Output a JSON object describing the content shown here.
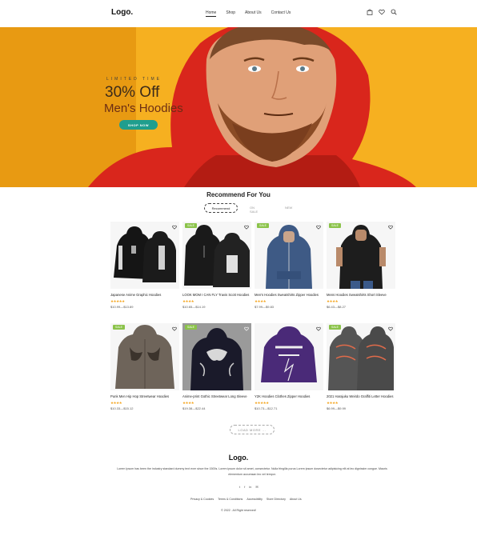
{
  "header": {
    "logo": "Logo.",
    "nav": [
      "Home",
      "Shop",
      "About Us",
      "Contact Us"
    ]
  },
  "hero": {
    "kicker": "LIMITED TIME",
    "title_line1": "30% Off",
    "title_line2": "Men's Hoodies",
    "button": "SHOP NOW"
  },
  "section": {
    "title": "Recommend For You",
    "tabs": [
      "Recommend",
      "ON SALE",
      "NEW"
    ]
  },
  "products": [
    {
      "name": "Japanese Anime Graphic Hoodies",
      "stars": "★★★★★",
      "price": "$10.99—$13.89",
      "sale": false,
      "sale_label": ""
    },
    {
      "name": "LOOK MOM I CAN FLY Travis Scott Hoodies",
      "stars": "★★★★",
      "price": "$10.65—$14.19",
      "sale": true,
      "sale_label": "SALE"
    },
    {
      "name": "Men's Hoodies Sweatshirts Zipper Hoodies",
      "stars": "★★★★",
      "price": "$7.99—$9.83",
      "sale": true,
      "sale_label": "SALE"
    },
    {
      "name": "Mens Hoodies Sweatshirts Short Sleeve",
      "stars": "★★★★",
      "price": "$6.43—$8.27",
      "sale": true,
      "sale_label": "SALE"
    },
    {
      "name": "Punk Men Hip Hop Streetwear Hoodies",
      "stars": "★★★★",
      "price": "$10.33—$15.12",
      "sale": true,
      "sale_label": "SALE"
    },
    {
      "name": "Anime-print Gothic Streetwear Long Sleeve",
      "stars": "★★★★",
      "price": "$19.38—$22.44",
      "sale": true,
      "sale_label": "SALE"
    },
    {
      "name": "Y2K Hoodies Clothes Zipper Hoodies",
      "stars": "★★★★★",
      "price": "$10.73—$12.71",
      "sale": false,
      "sale_label": ""
    },
    {
      "name": "2021 Harajuku Weirdo Graffiti Letter Hoodies",
      "stars": "★★★★",
      "price": "$6.99—$9.99",
      "sale": true,
      "sale_label": "SALE"
    }
  ],
  "load_more": "LOAD MORE ...",
  "footer": {
    "logo": "Logo.",
    "text": "Lorem Ipsum has been the industry standard dummy text ever since the 1500s. Lorem ipsum dolor sit amet, consectetur. Nulla fringilla purus Lorem ipsum dosectetur adipisicing elit at leo dignissim congue. Mauris elementum accumsan leo vel tempor.",
    "social": [
      "t",
      "f",
      "in",
      "✉"
    ],
    "links": [
      "Privacy & Cookies",
      "Terms & Conditions",
      "Accessibility",
      "Store Directory",
      "About Us"
    ],
    "copyright": "© 2022 . All Right reserved!"
  },
  "colors": {
    "hero_bg": "#f6b020",
    "accent": "#1f9e8e",
    "sale": "#8bc34a",
    "star": "#f4a41c"
  }
}
